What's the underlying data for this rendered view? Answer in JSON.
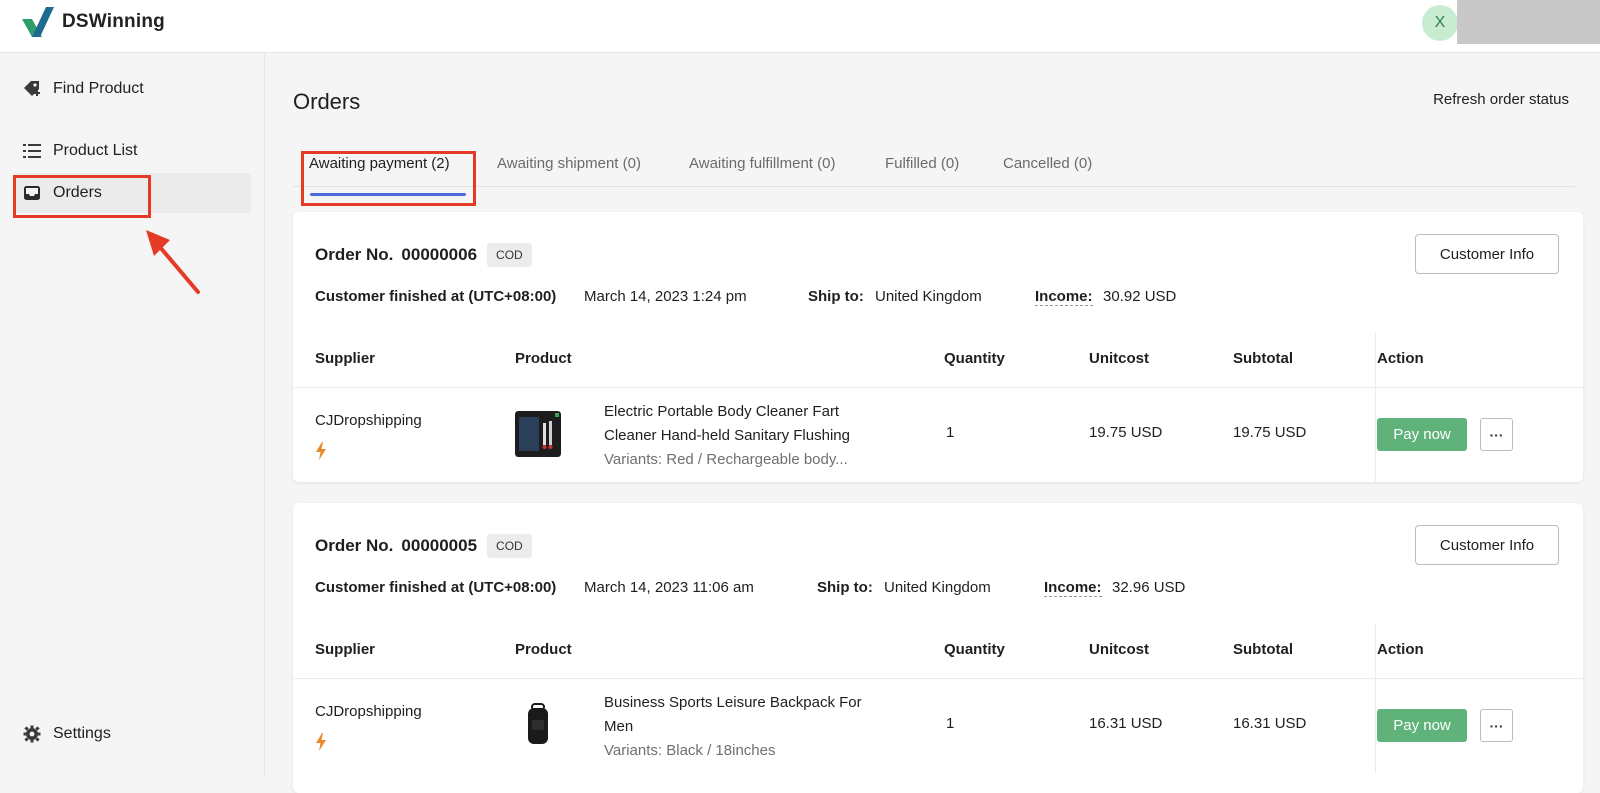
{
  "app": {
    "name": "DSWinning",
    "avatar_letter": "X"
  },
  "sidebar": {
    "items": [
      {
        "label": "Find Product",
        "icon": "tag-plus-icon"
      },
      {
        "label": "Product List",
        "icon": "list-icon"
      },
      {
        "label": "Orders",
        "icon": "inbox-icon"
      },
      {
        "label": "Settings",
        "icon": "gear-icon"
      }
    ]
  },
  "page": {
    "title": "Orders",
    "refresh_label": "Refresh order status"
  },
  "tabs": [
    {
      "label": "Awaiting payment (2)"
    },
    {
      "label": "Awaiting shipment (0)"
    },
    {
      "label": "Awaiting fulfillment (0)"
    },
    {
      "label": "Fulfilled (0)"
    },
    {
      "label": "Cancelled (0)"
    }
  ],
  "table_headers": {
    "supplier": "Supplier",
    "product": "Product",
    "quantity": "Quantity",
    "unitcost": "Unitcost",
    "subtotal": "Subtotal",
    "action": "Action"
  },
  "labels": {
    "order_no": "Order No.",
    "customer_finished": "Customer finished at (UTC+08:00)",
    "ship_to": "Ship to:",
    "income": "Income:",
    "customer_info": "Customer Info",
    "pay_now": "Pay now",
    "more": "···"
  },
  "orders": [
    {
      "number": "00000006",
      "payment_badge": "COD",
      "finished_at": "March 14, 2023 1:24 pm",
      "ship_to": "United Kingdom",
      "income": "30.92 USD",
      "item": {
        "supplier": "CJDropshipping",
        "product_line1": "Electric Portable Body Cleaner Fart",
        "product_line2": "Cleaner Hand-held Sanitary Flushing",
        "variants": "Variants: Red / Rechargeable body...",
        "quantity": "1",
        "unitcost": "19.75 USD",
        "subtotal": "19.75 USD"
      }
    },
    {
      "number": "00000005",
      "payment_badge": "COD",
      "finished_at": "March 14, 2023 11:06 am",
      "ship_to": "United Kingdom",
      "income": "32.96 USD",
      "item": {
        "supplier": "CJDropshipping",
        "product_line1": "Business Sports Leisure Backpack For",
        "product_line2": "Men",
        "variants": "Variants: Black / 18inches",
        "quantity": "1",
        "unitcost": "16.31 USD",
        "subtotal": "16.31 USD"
      }
    }
  ],
  "colors": {
    "accent_tab": "#4a6bdc",
    "pay_button": "#5fb27a",
    "highlight": "#e53a25",
    "bolt": "#e8892b"
  }
}
